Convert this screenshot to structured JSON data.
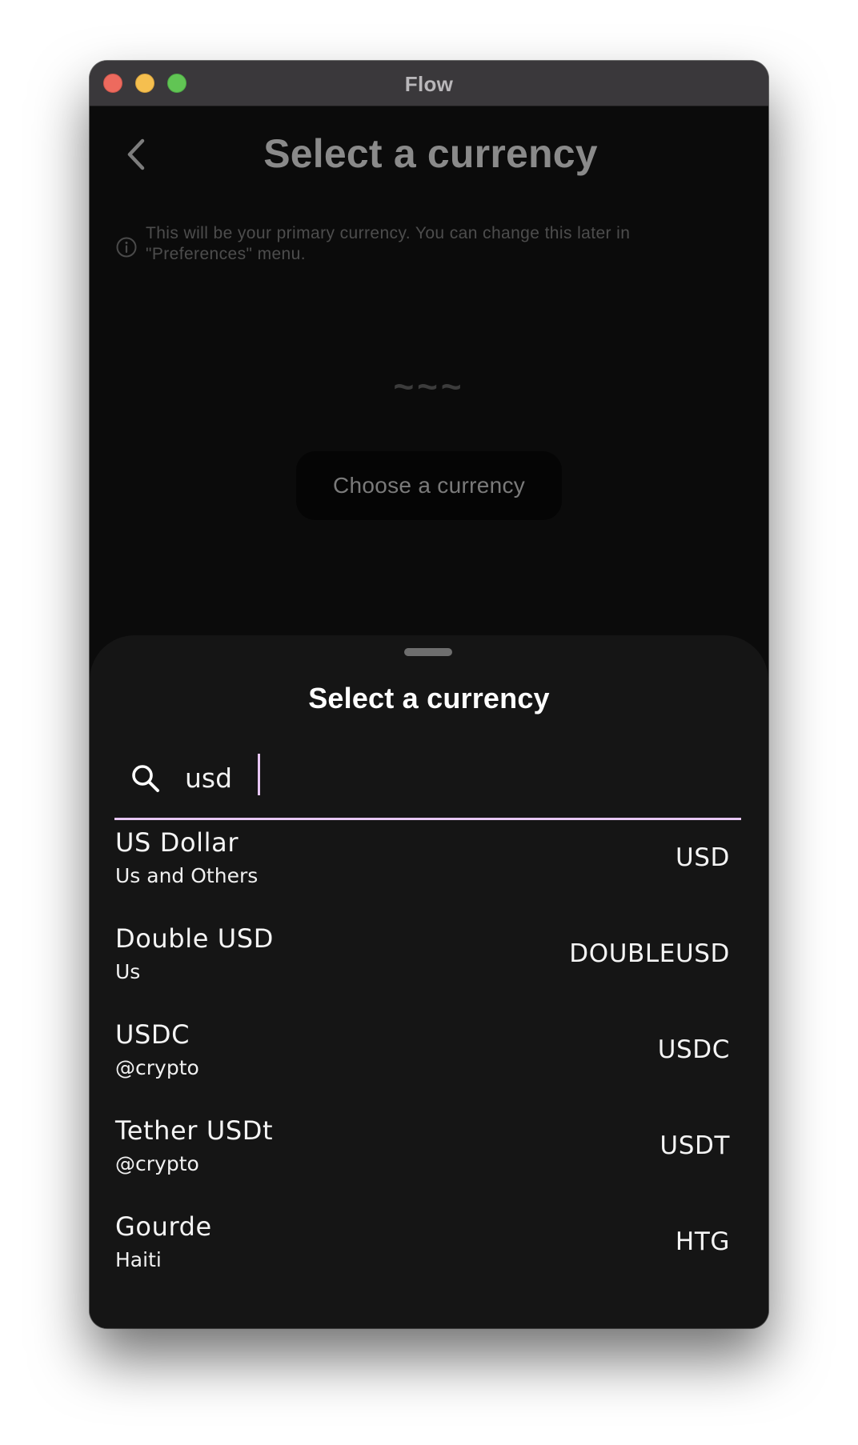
{
  "window": {
    "title": "Flow"
  },
  "page": {
    "title": "Select a currency",
    "info_text": "This will be your primary currency. You can change this later in \"Preferences\" menu.",
    "placeholder_glyph": "~~~",
    "choose_button_label": "Choose a currency"
  },
  "sheet": {
    "title": "Select a currency",
    "search": {
      "value": "usd"
    },
    "items": [
      {
        "name": "US Dollar",
        "region": "Us and Others",
        "code": "USD"
      },
      {
        "name": "Double USD",
        "region": "Us",
        "code": "DOUBLEUSD"
      },
      {
        "name": "USDC",
        "region": "@crypto",
        "code": "USDC"
      },
      {
        "name": "Tether USDt",
        "region": "@crypto",
        "code": "USDT"
      },
      {
        "name": "Gourde",
        "region": "Haiti",
        "code": "HTG"
      }
    ]
  },
  "colors": {
    "accent": "#e7c6f3",
    "sheet_background": "#151515",
    "page_background": "#0b0b0b",
    "titlebar": "#3a383b"
  },
  "icons": {
    "back": "chevron-left-icon",
    "info": "info-icon",
    "search": "search-icon"
  }
}
